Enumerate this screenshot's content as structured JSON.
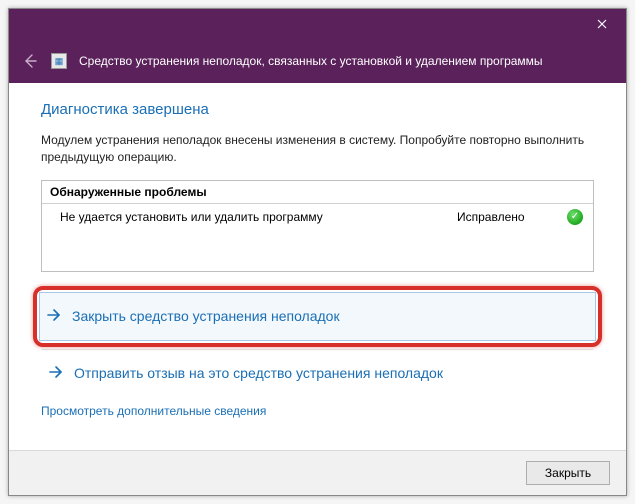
{
  "header": {
    "title": "Средство устранения неполадок, связанных с установкой и удалением программы"
  },
  "main": {
    "title": "Диагностика завершена",
    "description": "Модулем устранения неполадок внесены изменения в систему. Попробуйте повторно выполнить предыдущую операцию."
  },
  "problems": {
    "heading": "Обнаруженные проблемы",
    "rows": [
      {
        "name": "Не удается установить или удалить программу",
        "status": "Исправлено"
      }
    ]
  },
  "actions": {
    "close_troubleshooter": "Закрыть средство устранения неполадок",
    "send_feedback": "Отправить отзыв на это средство устранения неполадок"
  },
  "links": {
    "view_details": "Просмотреть дополнительные сведения"
  },
  "footer": {
    "close": "Закрыть"
  }
}
